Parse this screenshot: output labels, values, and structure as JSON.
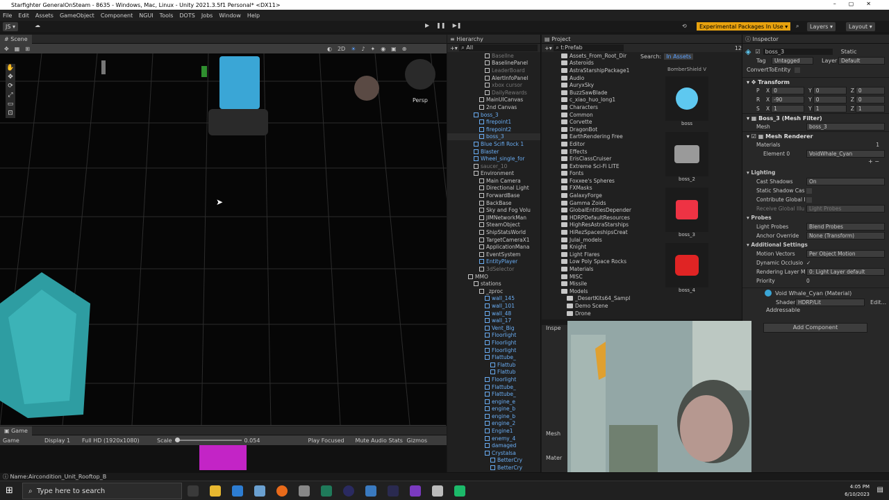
{
  "title_bar": {
    "text": "Starfighter GeneralOnSteam - 8635 - Windows, Mac, Linux - Unity 2021.3.5f1 Personal* <DX11>"
  },
  "menu": [
    "File",
    "Edit",
    "Assets",
    "GameObject",
    "Component",
    "NGUI",
    "Tools",
    "DOTS",
    "Jobs",
    "Window",
    "Help"
  ],
  "toolbar": {
    "account": "JS",
    "experimental": "Experimental Packages In Use",
    "layers": "Layers",
    "layout": "Layout"
  },
  "scene": {
    "tab": "Scene",
    "mode_2d": "2D",
    "persp": "Persp"
  },
  "game": {
    "tab": "Game",
    "game_dd": "Game",
    "display": "Display 1",
    "resolution": "Full HD (1920x1080)",
    "scale_label": "Scale",
    "scale_value": "0.054",
    "play_focused": "Play Focused",
    "mute": "Mute Audio",
    "stats": "Stats",
    "gizmos": "Gizmos"
  },
  "hierarchy": {
    "tab": "Hierarchy",
    "search": "All",
    "items": [
      {
        "label": "Basellne",
        "indent": 3,
        "style": "dim"
      },
      {
        "label": "BaselinePanel",
        "indent": 3,
        "style": "normal"
      },
      {
        "label": "LeaderBoard",
        "indent": 3,
        "style": "dim"
      },
      {
        "label": "AlertInfoPanel",
        "indent": 3,
        "style": "normal"
      },
      {
        "label": "xbox cursor",
        "indent": 3,
        "style": "dim"
      },
      {
        "label": "DailyRewards",
        "indent": 3,
        "style": "dim"
      },
      {
        "label": "MainUICanvas",
        "indent": 2,
        "style": "normal"
      },
      {
        "label": "2nd Canvas",
        "indent": 2,
        "style": "normal"
      },
      {
        "label": "boss_3",
        "indent": 1,
        "style": "blue"
      },
      {
        "label": "firepoint1",
        "indent": 2,
        "style": "blue"
      },
      {
        "label": "firepoint2",
        "indent": 2,
        "style": "blue"
      },
      {
        "label": "boss_3",
        "indent": 2,
        "style": "blue"
      },
      {
        "label": "Blue Scifi Rock 1",
        "indent": 1,
        "style": "blue"
      },
      {
        "label": "Blaster",
        "indent": 1,
        "style": "blue"
      },
      {
        "label": "Wheel_single_for",
        "indent": 1,
        "style": "blue"
      },
      {
        "label": "saucer_10",
        "indent": 1,
        "style": "dim"
      },
      {
        "label": "Environment",
        "indent": 1,
        "style": "normal"
      },
      {
        "label": "Main Camera",
        "indent": 2,
        "style": "normal"
      },
      {
        "label": "Directional Light",
        "indent": 2,
        "style": "normal"
      },
      {
        "label": "ForwardBase",
        "indent": 2,
        "style": "normal"
      },
      {
        "label": "BackBase",
        "indent": 2,
        "style": "normal"
      },
      {
        "label": "Sky and Fog Volu",
        "indent": 2,
        "style": "normal"
      },
      {
        "label": "JIMNetworkMan",
        "indent": 2,
        "style": "normal"
      },
      {
        "label": "SteamObject",
        "indent": 2,
        "style": "normal"
      },
      {
        "label": "ShipStatsWorld",
        "indent": 2,
        "style": "normal"
      },
      {
        "label": "TargetCameraX1",
        "indent": 2,
        "style": "normal"
      },
      {
        "label": "ApplicationMana",
        "indent": 2,
        "style": "normal"
      },
      {
        "label": "EventSystem",
        "indent": 2,
        "style": "normal"
      },
      {
        "label": "EntityPlayer",
        "indent": 2,
        "style": "blue"
      },
      {
        "label": "3dSelector",
        "indent": 2,
        "style": "dim"
      },
      {
        "label": "MMO",
        "indent": 0,
        "style": "normal"
      },
      {
        "label": "stations",
        "indent": 1,
        "style": "normal"
      },
      {
        "label": "_zproc",
        "indent": 2,
        "style": "normal"
      },
      {
        "label": "wall_145",
        "indent": 3,
        "style": "blue"
      },
      {
        "label": "wall_101",
        "indent": 3,
        "style": "blue"
      },
      {
        "label": "wall_48",
        "indent": 3,
        "style": "blue"
      },
      {
        "label": "wall_17",
        "indent": 3,
        "style": "blue"
      },
      {
        "label": "Vent_Big",
        "indent": 3,
        "style": "blue"
      },
      {
        "label": "Floorlight",
        "indent": 3,
        "style": "blue"
      },
      {
        "label": "Floorlight",
        "indent": 3,
        "style": "blue"
      },
      {
        "label": "Floorlight",
        "indent": 3,
        "style": "blue"
      },
      {
        "label": "Flattube_",
        "indent": 3,
        "style": "blue"
      },
      {
        "label": "Flattub",
        "indent": 4,
        "style": "blue"
      },
      {
        "label": "Flattub",
        "indent": 4,
        "style": "blue"
      },
      {
        "label": "Floorlight",
        "indent": 3,
        "style": "blue"
      },
      {
        "label": "Flattube_",
        "indent": 3,
        "style": "blue"
      },
      {
        "label": "Flattube_",
        "indent": 3,
        "style": "blue"
      },
      {
        "label": "engine_e",
        "indent": 3,
        "style": "blue"
      },
      {
        "label": "engine_b",
        "indent": 3,
        "style": "blue"
      },
      {
        "label": "engine_b",
        "indent": 3,
        "style": "blue"
      },
      {
        "label": "engine_2",
        "indent": 3,
        "style": "blue"
      },
      {
        "label": "Engine1",
        "indent": 3,
        "style": "blue"
      },
      {
        "label": "enemy_4",
        "indent": 3,
        "style": "blue"
      },
      {
        "label": "damaged",
        "indent": 3,
        "style": "blue"
      },
      {
        "label": "Crystalsa",
        "indent": 3,
        "style": "blue"
      },
      {
        "label": "BetterCry",
        "indent": 4,
        "style": "blue"
      },
      {
        "label": "BetterCry",
        "indent": 4,
        "style": "blue"
      }
    ]
  },
  "project": {
    "tab": "Project",
    "prefab_filter": "t:Prefab",
    "search_label": "Search:",
    "search_scope": "In Assets",
    "count": "12",
    "folders": [
      "Assets_From_Root_Dir",
      "Asteroids",
      "AstraStarshipPackage1",
      "Audio",
      "AuryxSky",
      "BuzzSawBlade",
      "c_xiao_huo_long1",
      "Characters",
      "Common",
      "Corvette",
      "DragonBot",
      "EarthRendering Free",
      "Editor",
      "Effects",
      "ErisClassCruiser",
      "Extreme Sci-Fi LITE",
      "Fonts",
      "Foxxee's Spheres",
      "FXMasks",
      "GalaxyForge",
      "Gamma Zoids",
      "GlobalEntitiesDepender",
      "HDRPDefaultResources",
      "HighResAstraStarships",
      "HiRezSpaceshipsCreat",
      "Julai_models",
      "Knight",
      "Light Flares",
      "Low Poly Space Rocks",
      "Materials",
      "MISC",
      "Missile",
      "Models",
      "_DesertKits64_Sampl",
      "Demo Scene",
      "Drone"
    ],
    "assets": [
      {
        "label": "BomberShield V",
        "color": "#888888"
      },
      {
        "label": "boss",
        "color": "#5ec8f0"
      },
      {
        "label": "boss_2",
        "color": "#9a9a9a"
      },
      {
        "label": "boss_3",
        "color": "#ee3344"
      },
      {
        "label": "boss_4",
        "color": "#e02424"
      }
    ]
  },
  "inspector": {
    "tab": "Inspector",
    "object_name": "boss_3",
    "static_label": "Static",
    "tag_label": "Tag",
    "tag_value": "Untagged",
    "layer_label": "Layer",
    "layer_value": "Default",
    "convert_label": "ConvertToEntity",
    "transform": {
      "title": "Transform",
      "p": [
        "0",
        "0",
        "0"
      ],
      "r": [
        "-90",
        "0",
        "0"
      ],
      "s": [
        "1",
        "1",
        "1"
      ]
    },
    "mesh_filter": {
      "title": "Boss_3 (Mesh Filter)",
      "mesh_label": "Mesh",
      "mesh_value": "boss_3"
    },
    "mesh_renderer": {
      "title": "Mesh Renderer",
      "materials_label": "Materials",
      "materials_count": "1",
      "element_label": "Element 0",
      "element_value": "VoidWhale_Cyan"
    },
    "lighting": {
      "title": "Lighting",
      "cast_shadows_label": "Cast Shadows",
      "cast_shadows_value": "On",
      "static_shadow_label": "Static Shadow Cas",
      "contribute_gi_label": "Contribute Global I",
      "receive_gi_label": "Receive Global Illu",
      "receive_gi_value": "Light Probes"
    },
    "probes": {
      "title": "Probes",
      "light_probes_label": "Light Probes",
      "light_probes_value": "Blend Probes",
      "anchor_label": "Anchor Override",
      "anchor_value": "None (Transform)"
    },
    "additional": {
      "title": "Additional Settings",
      "motion_label": "Motion Vectors",
      "motion_value": "Per Object Motion",
      "dynamic_label": "Dynamic Occlusio",
      "rendering_layer_label": "Rendering Layer M",
      "rendering_layer_value": "0: Light Layer default",
      "priority_label": "Priority",
      "priority_value": "0"
    },
    "material": {
      "title": "Void Whale_Cyan (Material)",
      "shader_label": "Shader",
      "shader_value": "HDRP/Lit",
      "edit_label": "Edit...",
      "addressable": "Addressable"
    },
    "add_component": "Add Component"
  },
  "mini_inspector": {
    "tab": "Inspe",
    "mesh": "Mesh",
    "mater": "Mater"
  },
  "status": {
    "text": "Name:Aircondition_Unit_Rooftop_B"
  },
  "taskbar": {
    "search_placeholder": "Type here to search",
    "time": "4:05 PM",
    "date": "6/10/2023"
  }
}
